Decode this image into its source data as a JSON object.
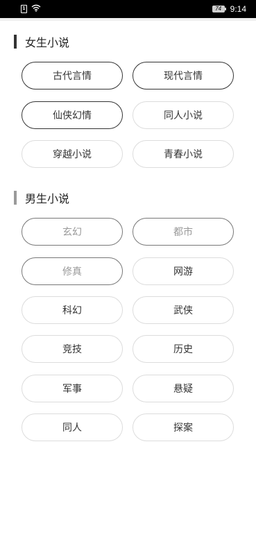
{
  "status_bar": {
    "sim_label": "1",
    "battery": "74",
    "time": "9:14"
  },
  "sections": [
    {
      "title": "女生小说",
      "bar_color": "#333333",
      "tags": [
        "古代言情",
        "现代言情",
        "仙侠幻情",
        "同人小说",
        "穿越小说",
        "青春小说"
      ]
    },
    {
      "title": "男生小说",
      "bar_color": "#9a9a9a",
      "tags": [
        "玄幻",
        "都市",
        "修真",
        "网游",
        "科幻",
        "武侠",
        "竞技",
        "历史",
        "军事",
        "悬疑",
        "同人",
        "探案"
      ]
    }
  ],
  "colors": {
    "status_bar_bg": "#000000",
    "page_bg": "#ffffff",
    "pill_border_default": "#dcdcdc",
    "pill_border_selected": "#333333"
  },
  "icons": {
    "sim": "sim-card-icon",
    "wifi": "wifi-icon",
    "battery": "battery-icon"
  }
}
